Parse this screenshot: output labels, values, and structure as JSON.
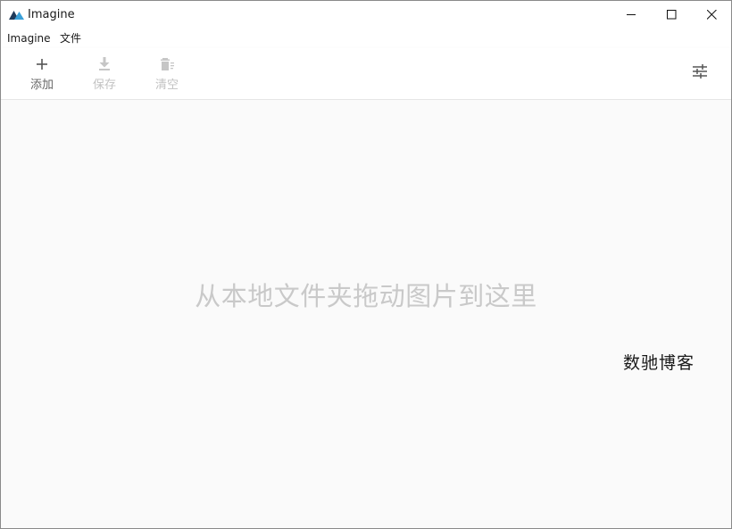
{
  "window": {
    "title": "Imagine"
  },
  "menu": {
    "items": [
      {
        "label": "Imagine"
      },
      {
        "label": "文件"
      }
    ]
  },
  "toolbar": {
    "add_label": "添加",
    "save_label": "保存",
    "clear_label": "清空",
    "icons": {
      "add": "plus-icon",
      "save": "download-icon",
      "clear": "trash-icon",
      "settings": "sliders-icon"
    },
    "enabled": {
      "add": true,
      "save": false,
      "clear": false
    }
  },
  "main": {
    "drop_hint": "从本地文件夹拖动图片到这里",
    "watermark": "数驰博客"
  },
  "colors": {
    "app_icon_primary": "#1f3a5a",
    "app_icon_accent": "#3aa0d8",
    "disabled_text": "#c2c2c2",
    "hint_text": "#c9c9c9",
    "background": "#fafafa"
  }
}
